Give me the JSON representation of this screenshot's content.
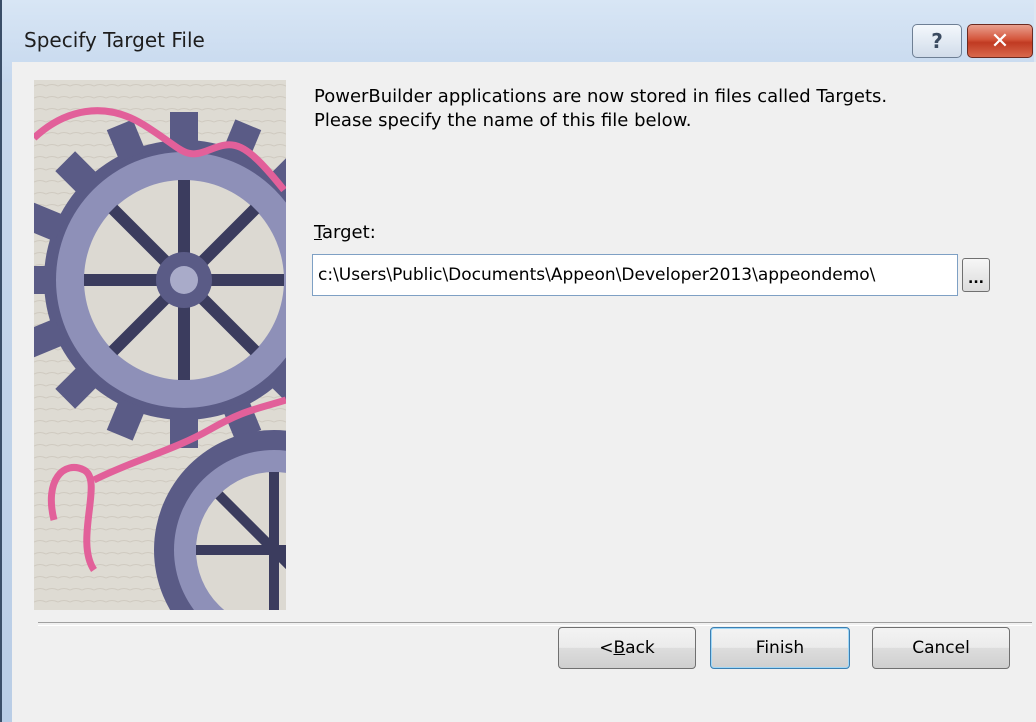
{
  "window": {
    "title": "Specify Target File",
    "help_label": "?",
    "close_label": "✕"
  },
  "intro": {
    "line1": "PowerBuilder applications are now stored in files called Targets.",
    "line2": "Please specify the name of this file below."
  },
  "target": {
    "label_first": "T",
    "label_rest": "arget:",
    "value": "c:\\Users\\Public\\Documents\\Appeon\\Developer2013\\appeondemo\\",
    "browse_label": "..."
  },
  "buttons": {
    "back_prefix": "< ",
    "back_accel": "B",
    "back_rest": "ack",
    "finish": "Finish",
    "cancel": "Cancel"
  },
  "colors": {
    "accent_pink": "#e2609a",
    "gear": "#6e6f97"
  }
}
